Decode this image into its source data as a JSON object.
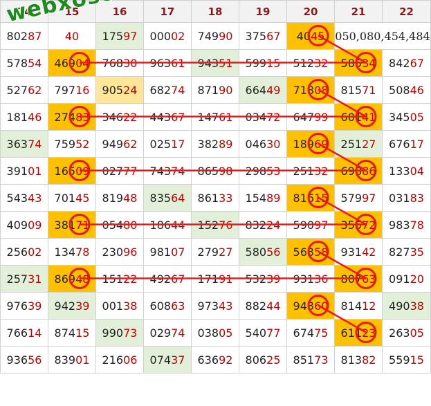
{
  "headers": [
    "14",
    "15",
    "16",
    "17",
    "18",
    "19",
    "20",
    "21",
    "22"
  ],
  "rows": [
    [
      {
        "v": "80287"
      },
      {
        "v": "40"
      },
      {
        "v": "17597",
        "c": "g"
      },
      {
        "v": "00002"
      },
      {
        "v": "74990"
      },
      {
        "v": "37567"
      },
      {
        "v": "4045",
        "c": "o"
      },
      {
        "v": "050,080,454,484",
        "special": true
      },
      null
    ],
    [
      {
        "v": "57854"
      },
      {
        "v": "46904",
        "c": "o"
      },
      {
        "v": "76830"
      },
      {
        "v": "96361"
      },
      {
        "v": "94351",
        "c": "g"
      },
      {
        "v": "59915"
      },
      {
        "v": "51232"
      },
      {
        "v": "58534",
        "c": "o"
      },
      {
        "v": "84267"
      }
    ],
    [
      {
        "v": "52762"
      },
      {
        "v": "79716"
      },
      {
        "v": "90524",
        "c": "y"
      },
      {
        "v": "68274"
      },
      {
        "v": "87190"
      },
      {
        "v": "66449",
        "c": "g"
      },
      {
        "v": "71808",
        "c": "o"
      },
      {
        "v": "81571"
      },
      {
        "v": "50846"
      }
    ],
    [
      {
        "v": "18146"
      },
      {
        "v": "27483",
        "c": "o"
      },
      {
        "v": "34622"
      },
      {
        "v": "44367"
      },
      {
        "v": "14761"
      },
      {
        "v": "03472"
      },
      {
        "v": "64799"
      },
      {
        "v": "60141",
        "c": "o"
      },
      {
        "v": "34505"
      }
    ],
    [
      {
        "v": "36374",
        "c": "g"
      },
      {
        "v": "75952"
      },
      {
        "v": "94962"
      },
      {
        "v": "02517"
      },
      {
        "v": "38289"
      },
      {
        "v": "04630"
      },
      {
        "v": "18969",
        "c": "o"
      },
      {
        "v": "25127",
        "c": "g"
      },
      {
        "v": "67617"
      }
    ],
    [
      {
        "v": "39101"
      },
      {
        "v": "16509",
        "c": "o"
      },
      {
        "v": "02777"
      },
      {
        "v": "74374"
      },
      {
        "v": "86598"
      },
      {
        "v": "29853"
      },
      {
        "v": "25132"
      },
      {
        "v": "69886",
        "c": "o"
      },
      {
        "v": "13304"
      }
    ],
    [
      {
        "v": "54343"
      },
      {
        "v": "70145"
      },
      {
        "v": "81948"
      },
      {
        "v": "83564",
        "c": "g"
      },
      {
        "v": "86133"
      },
      {
        "v": "15489"
      },
      {
        "v": "81615",
        "c": "o"
      },
      {
        "v": "57997"
      },
      {
        "v": "03183"
      }
    ],
    [
      {
        "v": "40909"
      },
      {
        "v": "38171",
        "c": "o"
      },
      {
        "v": "05480"
      },
      {
        "v": "18644"
      },
      {
        "v": "15276",
        "c": "g"
      },
      {
        "v": "83224"
      },
      {
        "v": "59097"
      },
      {
        "v": "35572",
        "c": "o"
      },
      {
        "v": "98378"
      }
    ],
    [
      {
        "v": "25602"
      },
      {
        "v": "13478"
      },
      {
        "v": "23096"
      },
      {
        "v": "98107"
      },
      {
        "v": "27927"
      },
      {
        "v": "58056",
        "c": "g"
      },
      {
        "v": "56358",
        "c": "o"
      },
      {
        "v": "93142"
      },
      {
        "v": "82735"
      }
    ],
    [
      {
        "v": "25731",
        "c": "g"
      },
      {
        "v": "86948",
        "c": "o"
      },
      {
        "v": "15122"
      },
      {
        "v": "49267"
      },
      {
        "v": "17191"
      },
      {
        "v": "53239"
      },
      {
        "v": "93136"
      },
      {
        "v": "80763",
        "c": "o"
      },
      {
        "v": "09120"
      }
    ],
    [
      {
        "v": "97639"
      },
      {
        "v": "94239",
        "c": "g"
      },
      {
        "v": "00138"
      },
      {
        "v": "60863"
      },
      {
        "v": "97343"
      },
      {
        "v": "88244"
      },
      {
        "v": "94360",
        "c": "o"
      },
      {
        "v": "81412"
      },
      {
        "v": "49038",
        "c": "g"
      }
    ],
    [
      {
        "v": "76614"
      },
      {
        "v": "87415"
      },
      {
        "v": "99073",
        "c": "g"
      },
      {
        "v": "02974"
      },
      {
        "v": "03805"
      },
      {
        "v": "54077"
      },
      {
        "v": "67475"
      },
      {
        "v": "61123",
        "c": "o"
      },
      {
        "v": "26305"
      }
    ],
    [
      {
        "v": "93656"
      },
      {
        "v": "83901"
      },
      {
        "v": "21606"
      },
      {
        "v": "07437",
        "c": "g"
      },
      {
        "v": "63692"
      },
      {
        "v": "80625"
      },
      {
        "v": "85173"
      },
      {
        "v": "81382"
      },
      {
        "v": "55915"
      }
    ]
  ],
  "circles": [
    {
      "row": 0,
      "col": 6
    },
    {
      "row": 1,
      "col": 1
    },
    {
      "row": 1,
      "col": 7
    },
    {
      "row": 2,
      "col": 6
    },
    {
      "row": 3,
      "col": 1
    },
    {
      "row": 3,
      "col": 7
    },
    {
      "row": 4,
      "col": 6
    },
    {
      "row": 5,
      "col": 1
    },
    {
      "row": 5,
      "col": 7
    },
    {
      "row": 6,
      "col": 6
    },
    {
      "row": 7,
      "col": 1
    },
    {
      "row": 7,
      "col": 7
    },
    {
      "row": 8,
      "col": 6
    },
    {
      "row": 9,
      "col": 1
    },
    {
      "row": 9,
      "col": 7
    },
    {
      "row": 10,
      "col": 6
    },
    {
      "row": 11,
      "col": 7
    }
  ],
  "lines": [
    {
      "from": {
        "row": 1,
        "col": 1
      },
      "to": {
        "row": 1,
        "col": 7
      }
    },
    {
      "from": {
        "row": 3,
        "col": 1
      },
      "to": {
        "row": 3,
        "col": 7
      }
    },
    {
      "from": {
        "row": 5,
        "col": 1
      },
      "to": {
        "row": 5,
        "col": 7
      }
    },
    {
      "from": {
        "row": 7,
        "col": 1
      },
      "to": {
        "row": 7,
        "col": 7
      }
    },
    {
      "from": {
        "row": 9,
        "col": 1
      },
      "to": {
        "row": 9,
        "col": 7
      }
    },
    {
      "from": {
        "row": 0,
        "col": 6
      },
      "to": {
        "row": 1,
        "col": 7
      }
    },
    {
      "from": {
        "row": 2,
        "col": 6
      },
      "to": {
        "row": 3,
        "col": 7
      }
    },
    {
      "from": {
        "row": 4,
        "col": 6
      },
      "to": {
        "row": 5,
        "col": 7
      }
    },
    {
      "from": {
        "row": 6,
        "col": 6
      },
      "to": {
        "row": 7,
        "col": 7
      }
    },
    {
      "from": {
        "row": 8,
        "col": 6
      },
      "to": {
        "row": 9,
        "col": 7
      }
    },
    {
      "from": {
        "row": 10,
        "col": 6
      },
      "to": {
        "row": 11,
        "col": 7
      }
    }
  ],
  "colors": {
    "mark": "#e8191c",
    "header_text": "#8b1a1a",
    "orange": "#ffc000",
    "green": "#e2f0d9",
    "yellow": "#ffe699"
  },
  "watermark": "webxoso.net"
}
